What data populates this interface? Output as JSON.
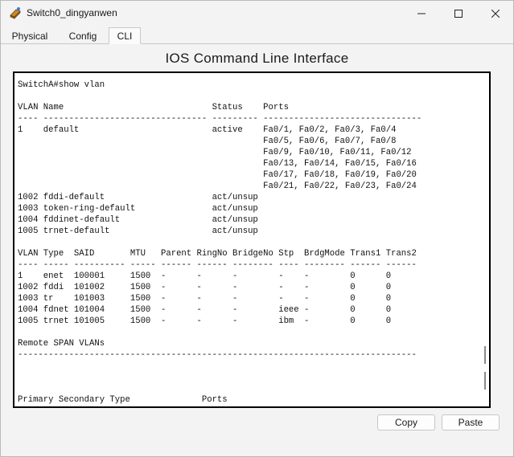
{
  "window": {
    "title": "Switch0_dingyanwen",
    "icon": "switch-app-icon"
  },
  "tabs": [
    {
      "label": "Physical",
      "active": false
    },
    {
      "label": "Config",
      "active": false
    },
    {
      "label": "CLI",
      "active": true
    }
  ],
  "cli": {
    "heading": "IOS Command Line Interface",
    "output": "SwitchA#show vlan\n\nVLAN Name                             Status    Ports\n---- -------------------------------- --------- -------------------------------\n1    default                          active    Fa0/1, Fa0/2, Fa0/3, Fa0/4\n                                                Fa0/5, Fa0/6, Fa0/7, Fa0/8\n                                                Fa0/9, Fa0/10, Fa0/11, Fa0/12\n                                                Fa0/13, Fa0/14, Fa0/15, Fa0/16\n                                                Fa0/17, Fa0/18, Fa0/19, Fa0/20\n                                                Fa0/21, Fa0/22, Fa0/23, Fa0/24\n1002 fddi-default                     act/unsup\n1003 token-ring-default               act/unsup\n1004 fddinet-default                  act/unsup\n1005 trnet-default                    act/unsup\n\nVLAN Type  SAID       MTU   Parent RingNo BridgeNo Stp  BrdgMode Trans1 Trans2\n---- ----- ---------- ----- ------ ------ -------- ---- -------- ------ ------\n1    enet  100001     1500  -      -      -        -    -        0      0\n1002 fddi  101002     1500  -      -      -        -    -        0      0\n1003 tr    101003     1500  -      -      -        -    -        0      0\n1004 fdnet 101004     1500  -      -      -        ieee -        0      0\n1005 trnet 101005     1500  -      -      -        ibm  -        0      0\n\nRemote SPAN VLANs\n------------------------------------------------------------------------------\n\n\n\nPrimary Secondary Type              Ports\n------- --------- ----------------- ------------------------------------------"
  },
  "buttons": {
    "copy": "Copy",
    "paste": "Paste"
  }
}
